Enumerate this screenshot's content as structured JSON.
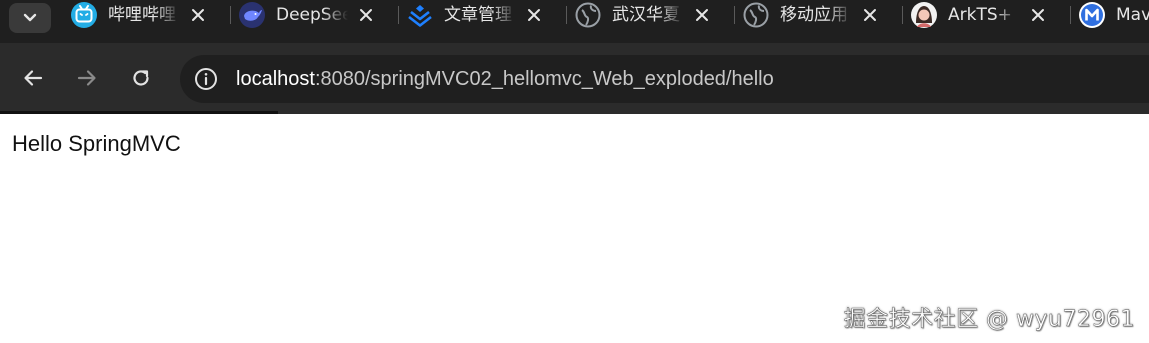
{
  "browser": {
    "tabs": [
      {
        "title": "哔哩哔哩",
        "icon": "bilibili-icon",
        "color": "#23ade5"
      },
      {
        "title": "DeepSeek",
        "icon": "deepseek-whale-icon",
        "color": "#4d6bfe"
      },
      {
        "title": "文章管理",
        "icon": "juejin-icon",
        "color": "#1e80ff"
      },
      {
        "title": "武汉华夏",
        "icon": "globe-icon",
        "color": "#9aa0a6"
      },
      {
        "title": "移动应用",
        "icon": "globe-icon",
        "color": "#9aa0a6"
      },
      {
        "title": "ArkTS+",
        "icon": "avatar-icon",
        "color": "#f4c7b8"
      },
      {
        "title": "Maven",
        "icon": "m-logo-icon",
        "color": "#2f6fe0"
      }
    ],
    "omnibox": {
      "host": "localhost",
      "path": ":8080/springMVC02_hellomvc_Web_exploded/hello"
    }
  },
  "page": {
    "body_text": "Hello SpringMVC"
  },
  "watermark": "掘金技术社区 @ wyu72961"
}
